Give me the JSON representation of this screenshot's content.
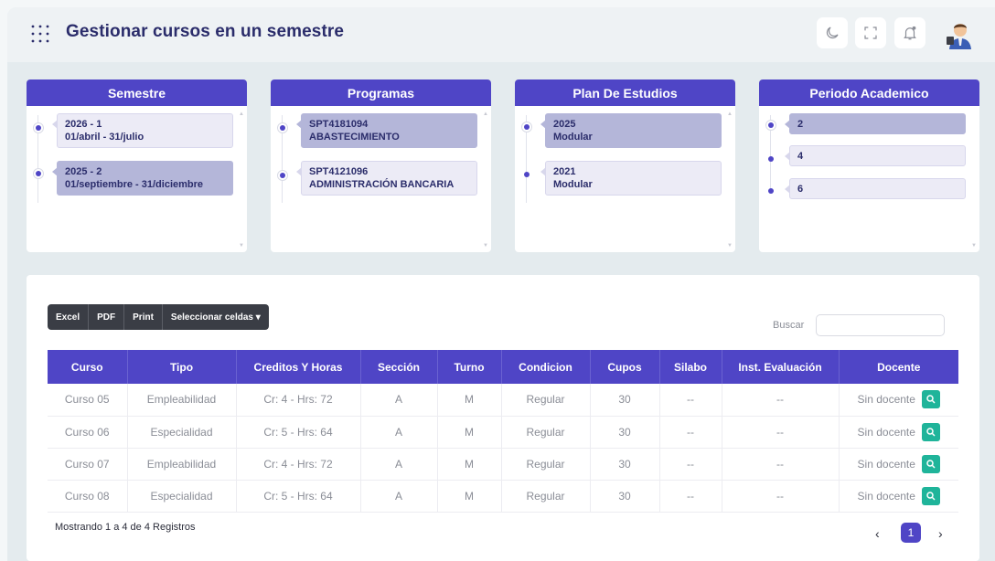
{
  "header": {
    "title": "Gestionar cursos en un semestre",
    "icons": [
      "grid-icon",
      "moon-icon",
      "fullscreen-icon",
      "bell-icon",
      "avatar"
    ]
  },
  "cards": [
    {
      "title": "Semestre",
      "items": [
        {
          "line1": "2026 - 1",
          "line2": "01/abril - 31/julio",
          "selected": false
        },
        {
          "line1": "2025 - 2",
          "line2": "01/septiembre - 31/diciembre",
          "selected": true
        }
      ]
    },
    {
      "title": "Programas",
      "items": [
        {
          "line1": "SPT4181094",
          "line2": "ABASTECIMIENTO",
          "selected": true
        },
        {
          "line1": "SPT4121096",
          "line2": "ADMINISTRACIÓN BANCARIA",
          "selected": false
        }
      ]
    },
    {
      "title": "Plan De Estudios",
      "items": [
        {
          "line1": "2025",
          "line2": "Modular",
          "selected": true
        },
        {
          "line1": "2021",
          "line2": "Modular",
          "selected": false
        }
      ]
    },
    {
      "title": "Periodo Academico",
      "items": [
        {
          "line1": "2",
          "selected": true
        },
        {
          "line1": "4",
          "selected": false
        },
        {
          "line1": "6",
          "selected": false
        }
      ]
    }
  ],
  "toolbar": {
    "excel": "Excel",
    "pdf": "PDF",
    "print": "Print",
    "select": "Seleccionar celdas ▾"
  },
  "search": {
    "label": "Buscar",
    "value": ""
  },
  "table": {
    "headers": [
      "Curso",
      "Tipo",
      "Creditos Y Horas",
      "Sección",
      "Turno",
      "Condicion",
      "Cupos",
      "Silabo",
      "Inst. Evaluación",
      "Docente"
    ],
    "rows": [
      [
        "Curso 05",
        "Empleabilidad",
        "Cr: 4 - Hrs: 72",
        "A",
        "M",
        "Regular",
        "30",
        "--",
        "--",
        "Sin docente"
      ],
      [
        "Curso 06",
        "Especialidad",
        "Cr: 5 - Hrs: 64",
        "A",
        "M",
        "Regular",
        "30",
        "--",
        "--",
        "Sin docente"
      ],
      [
        "Curso 07",
        "Empleabilidad",
        "Cr: 4 - Hrs: 72",
        "A",
        "M",
        "Regular",
        "30",
        "--",
        "--",
        "Sin docente"
      ],
      [
        "Curso 08",
        "Especialidad",
        "Cr: 5 - Hrs: 64",
        "A",
        "M",
        "Regular",
        "30",
        "--",
        "--",
        "Sin docente"
      ]
    ]
  },
  "footer": {
    "info": "Mostrando 1 a 4 de 4 Registros",
    "prev": "‹",
    "page": "1",
    "next": "›"
  },
  "colors": {
    "accent": "#4f45c6",
    "teal": "#1fb49a",
    "selected_item": "#b4b6d9",
    "item_bg": "#ecebf6"
  }
}
